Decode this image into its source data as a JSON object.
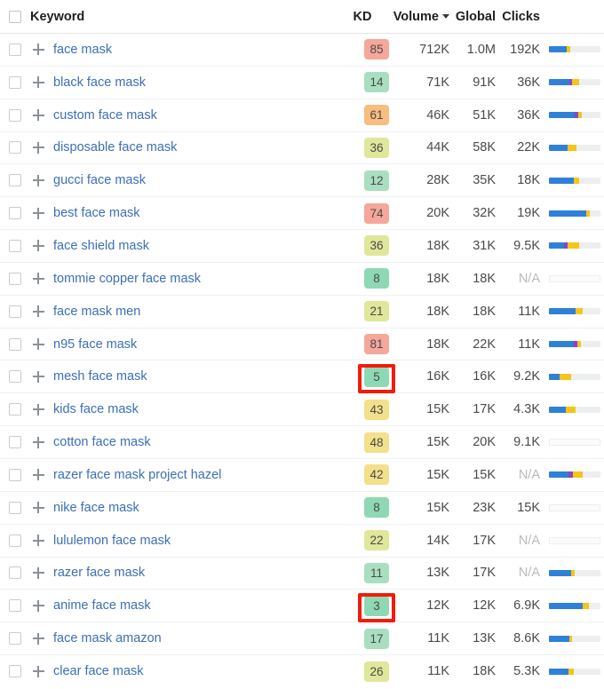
{
  "header": {
    "select_all_checkbox": "",
    "columns": {
      "keyword": "Keyword",
      "kd": "KD",
      "volume": "Volume",
      "global": "Global",
      "clicks": "Clicks"
    },
    "sort_icon": "caret-down-icon",
    "sorted_by": "Volume",
    "sort_direction": "descending"
  },
  "colors": {
    "link": "#3b6fb8",
    "kd_high": "#f5a79b",
    "kd_mediumhigh": "#f8bd7f",
    "kd_medium": "#f3e08a",
    "kd_mediumlow": "#e0e79a",
    "kd_low": "#a9dfc0",
    "kd_verylow": "#8ed9b4",
    "bar_blue": "#2f80d8",
    "bar_purple": "#8e44c4",
    "bar_yellow": "#f5c518",
    "bar_track": "#eceef0",
    "highlight_box": "#f41b06"
  },
  "rows": [
    {
      "keyword": "face mask",
      "kd": "85",
      "kd_color": "#f5a79b",
      "volume": "712K",
      "global": "1.0M",
      "clicks": "192K",
      "bar": {
        "empty": false,
        "blue": 34,
        "purple": 0,
        "yellow": 8
      },
      "highlighted": false
    },
    {
      "keyword": "black face mask",
      "kd": "14",
      "kd_color": "#a9dfc0",
      "volume": "71K",
      "global": "91K",
      "clicks": "36K",
      "bar": {
        "empty": false,
        "blue": 40,
        "purple": 5,
        "yellow": 13
      },
      "highlighted": false
    },
    {
      "keyword": "custom face mask",
      "kd": "61",
      "kd_color": "#f8bd7f",
      "volume": "46K",
      "global": "51K",
      "clicks": "36K",
      "bar": {
        "empty": false,
        "blue": 50,
        "purple": 7,
        "yellow": 6
      },
      "highlighted": false
    },
    {
      "keyword": "disposable face mask",
      "kd": "36",
      "kd_color": "#e0e79a",
      "volume": "44K",
      "global": "58K",
      "clicks": "22K",
      "bar": {
        "empty": false,
        "blue": 36,
        "purple": 0,
        "yellow": 18
      },
      "highlighted": false
    },
    {
      "keyword": "gucci face mask",
      "kd": "12",
      "kd_color": "#a9dfc0",
      "volume": "28K",
      "global": "35K",
      "clicks": "18K",
      "bar": {
        "empty": false,
        "blue": 49,
        "purple": 0,
        "yellow": 10
      },
      "highlighted": false
    },
    {
      "keyword": "best face mask",
      "kd": "74",
      "kd_color": "#f5a79b",
      "volume": "20K",
      "global": "32K",
      "clicks": "19K",
      "bar": {
        "empty": false,
        "blue": 72,
        "purple": 0,
        "yellow": 8
      },
      "highlighted": false
    },
    {
      "keyword": "face shield mask",
      "kd": "36",
      "kd_color": "#e0e79a",
      "volume": "18K",
      "global": "31K",
      "clicks": "9.5K",
      "bar": {
        "empty": false,
        "blue": 30,
        "purple": 6,
        "yellow": 22
      },
      "highlighted": false
    },
    {
      "keyword": "tommie copper face mask",
      "kd": "8",
      "kd_color": "#8ed9b4",
      "volume": "18K",
      "global": "18K",
      "clicks": "N/A",
      "bar": {
        "empty": true,
        "blue": 0,
        "purple": 0,
        "yellow": 0
      },
      "highlighted": false
    },
    {
      "keyword": "face mask men",
      "kd": "21",
      "kd_color": "#e0e79a",
      "volume": "18K",
      "global": "18K",
      "clicks": "11K",
      "bar": {
        "empty": false,
        "blue": 52,
        "purple": 0,
        "yellow": 14
      },
      "highlighted": false
    },
    {
      "keyword": "n95 face mask",
      "kd": "81",
      "kd_color": "#f5a79b",
      "volume": "18K",
      "global": "22K",
      "clicks": "11K",
      "bar": {
        "empty": false,
        "blue": 49,
        "purple": 7,
        "yellow": 6
      },
      "highlighted": false
    },
    {
      "keyword": "mesh face mask",
      "kd": "5",
      "kd_color": "#8ed9b4",
      "volume": "16K",
      "global": "16K",
      "clicks": "9.2K",
      "bar": {
        "empty": false,
        "blue": 20,
        "purple": 0,
        "yellow": 23
      },
      "highlighted": true
    },
    {
      "keyword": "kids face mask",
      "kd": "43",
      "kd_color": "#f3e08a",
      "volume": "15K",
      "global": "17K",
      "clicks": "4.3K",
      "bar": {
        "empty": false,
        "blue": 33,
        "purple": 0,
        "yellow": 18
      },
      "highlighted": false
    },
    {
      "keyword": "cotton face mask",
      "kd": "48",
      "kd_color": "#f3e08a",
      "volume": "15K",
      "global": "20K",
      "clicks": "9.1K",
      "bar": {
        "empty": true,
        "blue": 0,
        "purple": 0,
        "yellow": 0
      },
      "highlighted": false
    },
    {
      "keyword": "razer face mask project hazel",
      "kd": "42",
      "kd_color": "#f3e08a",
      "volume": "15K",
      "global": "15K",
      "clicks": "N/A",
      "bar": {
        "empty": false,
        "blue": 38,
        "purple": 8,
        "yellow": 19
      },
      "highlighted": false
    },
    {
      "keyword": "nike face mask",
      "kd": "8",
      "kd_color": "#8ed9b4",
      "volume": "15K",
      "global": "23K",
      "clicks": "15K",
      "bar": {
        "empty": true,
        "blue": 0,
        "purple": 0,
        "yellow": 0
      },
      "highlighted": false
    },
    {
      "keyword": "lululemon face mask",
      "kd": "22",
      "kd_color": "#e0e79a",
      "volume": "14K",
      "global": "17K",
      "clicks": "N/A",
      "bar": {
        "empty": true,
        "blue": 0,
        "purple": 0,
        "yellow": 0
      },
      "highlighted": false
    },
    {
      "keyword": "razer face mask",
      "kd": "11",
      "kd_color": "#a9dfc0",
      "volume": "13K",
      "global": "17K",
      "clicks": "N/A",
      "bar": {
        "empty": false,
        "blue": 43,
        "purple": 0,
        "yellow": 7
      },
      "highlighted": false
    },
    {
      "keyword": "anime face mask",
      "kd": "3",
      "kd_color": "#8ed9b4",
      "volume": "12K",
      "global": "12K",
      "clicks": "6.9K",
      "bar": {
        "empty": false,
        "blue": 65,
        "purple": 0,
        "yellow": 13
      },
      "highlighted": true
    },
    {
      "keyword": "face mask amazon",
      "kd": "17",
      "kd_color": "#a9dfc0",
      "volume": "11K",
      "global": "13K",
      "clicks": "8.6K",
      "bar": {
        "empty": false,
        "blue": 40,
        "purple": 0,
        "yellow": 5
      },
      "highlighted": false
    },
    {
      "keyword": "clear face mask",
      "kd": "26",
      "kd_color": "#e0e79a",
      "volume": "11K",
      "global": "18K",
      "clicks": "5.3K",
      "bar": {
        "empty": false,
        "blue": 38,
        "purple": 0,
        "yellow": 10
      },
      "highlighted": false
    }
  ]
}
